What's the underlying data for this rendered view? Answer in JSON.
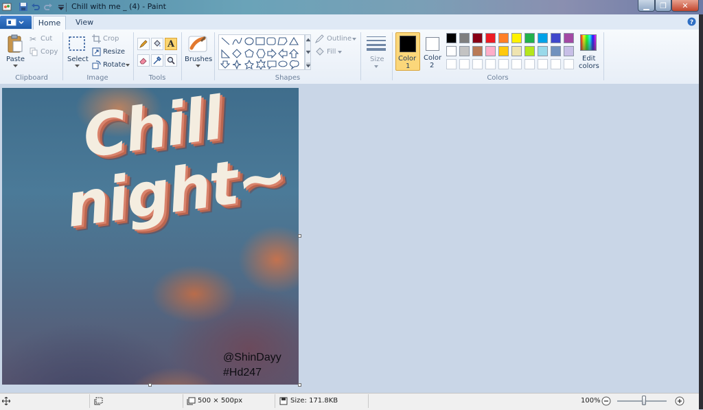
{
  "window": {
    "title": "Chill with me _ (4) - Paint"
  },
  "tabs": [
    {
      "label": "Home"
    },
    {
      "label": "View"
    }
  ],
  "ribbon": {
    "clipboard": {
      "paste": "Paste",
      "cut": "Cut",
      "copy": "Copy",
      "group": "Clipboard"
    },
    "image": {
      "select": "Select",
      "crop": "Crop",
      "resize": "Resize",
      "rotate": "Rotate",
      "group": "Image"
    },
    "tools": {
      "group": "Tools"
    },
    "brushes": {
      "label": "Brushes"
    },
    "shapes": {
      "outline": "Outline",
      "fill": "Fill",
      "group": "Shapes"
    },
    "size": {
      "label": "Size"
    },
    "colors": {
      "color1_label": "Color",
      "color1_num": "1",
      "color2_label": "Color",
      "color2_num": "2",
      "edit_label": "Edit",
      "edit_label2": "colors",
      "group": "Colors",
      "color1": "#000000",
      "color2": "#ffffff",
      "palette_row1": [
        "#000000",
        "#7f7f7f",
        "#880015",
        "#ed1c24",
        "#ff7f27",
        "#fff200",
        "#22b14c",
        "#00a2e8",
        "#3f48cc",
        "#a349a4"
      ],
      "palette_row2": [
        "#ffffff",
        "#c3c3c3",
        "#b97a57",
        "#ffaec9",
        "#ffc90e",
        "#efe4b0",
        "#b5e61d",
        "#99d9ea",
        "#7092be",
        "#c8bfe7"
      ]
    }
  },
  "canvas": {
    "line1": "Chill",
    "line2": "night~",
    "credit1": "@ShinDayy",
    "credit2": "#Hd247"
  },
  "status": {
    "dimensions": "500 × 500px",
    "size": "Size: 171.8KB",
    "zoom": "100%",
    "zoom_level_percent": 100
  }
}
